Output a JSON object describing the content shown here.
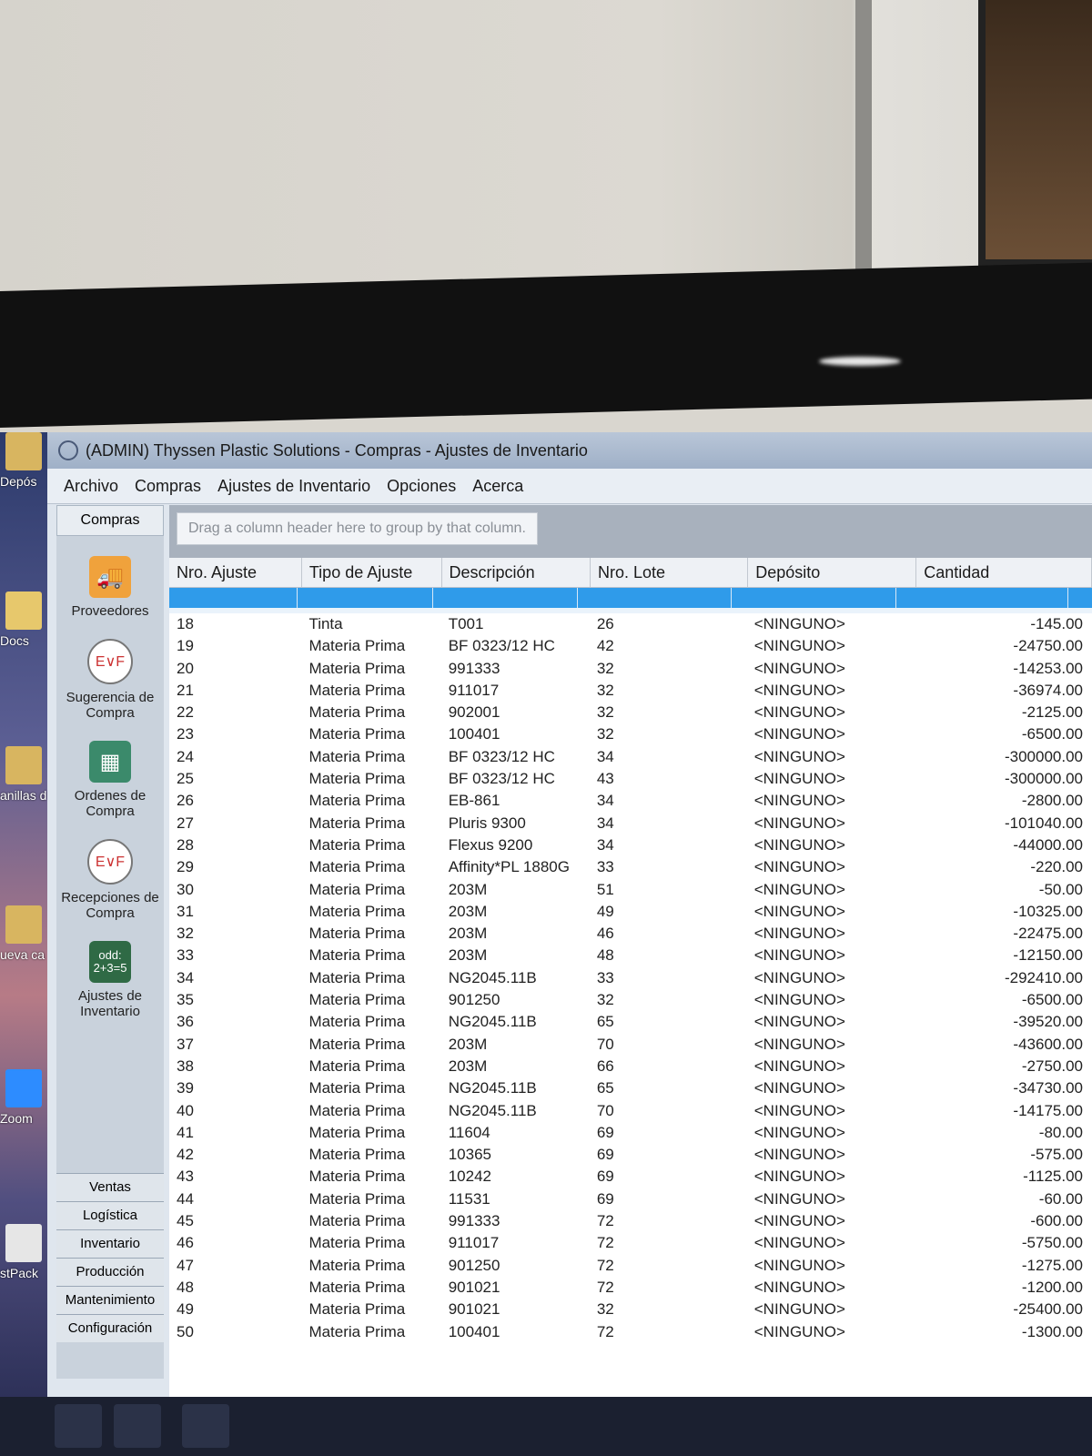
{
  "window": {
    "title": "(ADMIN) Thyssen Plastic Solutions - Compras - Ajustes de Inventario"
  },
  "menu": [
    "Archivo",
    "Compras",
    "Ajustes de Inventario",
    "Opciones",
    "Acerca"
  ],
  "desktop_icons": [
    "Depós",
    "Docs",
    "anillas d",
    "ueva ca",
    "Zoom",
    "stPack"
  ],
  "sidebar": {
    "header": "Compras",
    "items": [
      {
        "label": "Proveedores",
        "icon": "truck-icon"
      },
      {
        "label": "Sugerencia de Compra",
        "icon": "gauge-icon"
      },
      {
        "label": "Ordenes de Compra",
        "icon": "calculator-icon"
      },
      {
        "label": "Recepciones de Compra",
        "icon": "gauge-icon"
      },
      {
        "label": "Ajustes de Inventario",
        "icon": "sum-icon",
        "icon_text": "odd: 2+3=5"
      }
    ],
    "sections": [
      "Ventas",
      "Logística",
      "Inventario",
      "Producción",
      "Mantenimiento",
      "Configuración"
    ]
  },
  "grid": {
    "group_hint": "Drag a column header here to group by that column.",
    "columns": [
      "Nro. Ajuste",
      "Tipo de Ajuste",
      "Descripción",
      "Nro. Lote",
      "Depósito",
      "Cantidad"
    ],
    "rows": [
      [
        "18",
        "Tinta",
        "T001",
        "26",
        "<NINGUNO>",
        "-145.00"
      ],
      [
        "19",
        "Materia Prima",
        "BF 0323/12 HC",
        "42",
        "<NINGUNO>",
        "-24750.00"
      ],
      [
        "20",
        "Materia Prima",
        "991333",
        "32",
        "<NINGUNO>",
        "-14253.00"
      ],
      [
        "21",
        "Materia Prima",
        "911017",
        "32",
        "<NINGUNO>",
        "-36974.00"
      ],
      [
        "22",
        "Materia Prima",
        "902001",
        "32",
        "<NINGUNO>",
        "-2125.00"
      ],
      [
        "23",
        "Materia Prima",
        "100401",
        "32",
        "<NINGUNO>",
        "-6500.00"
      ],
      [
        "24",
        "Materia Prima",
        "BF 0323/12 HC",
        "34",
        "<NINGUNO>",
        "-300000.00"
      ],
      [
        "25",
        "Materia Prima",
        "BF 0323/12 HC",
        "43",
        "<NINGUNO>",
        "-300000.00"
      ],
      [
        "26",
        "Materia Prima",
        "EB-861",
        "34",
        "<NINGUNO>",
        "-2800.00"
      ],
      [
        "27",
        "Materia Prima",
        "Pluris 9300",
        "34",
        "<NINGUNO>",
        "-101040.00"
      ],
      [
        "28",
        "Materia Prima",
        "Flexus 9200",
        "34",
        "<NINGUNO>",
        "-44000.00"
      ],
      [
        "29",
        "Materia Prima",
        "Affinity*PL 1880G",
        "33",
        "<NINGUNO>",
        "-220.00"
      ],
      [
        "30",
        "Materia Prima",
        "203M",
        "51",
        "<NINGUNO>",
        "-50.00"
      ],
      [
        "31",
        "Materia Prima",
        "203M",
        "49",
        "<NINGUNO>",
        "-10325.00"
      ],
      [
        "32",
        "Materia Prima",
        "203M",
        "46",
        "<NINGUNO>",
        "-22475.00"
      ],
      [
        "33",
        "Materia Prima",
        "203M",
        "48",
        "<NINGUNO>",
        "-12150.00"
      ],
      [
        "34",
        "Materia Prima",
        "NG2045.11B",
        "33",
        "<NINGUNO>",
        "-292410.00"
      ],
      [
        "35",
        "Materia Prima",
        "901250",
        "32",
        "<NINGUNO>",
        "-6500.00"
      ],
      [
        "36",
        "Materia Prima",
        "NG2045.11B",
        "65",
        "<NINGUNO>",
        "-39520.00"
      ],
      [
        "37",
        "Materia Prima",
        "203M",
        "70",
        "<NINGUNO>",
        "-43600.00"
      ],
      [
        "38",
        "Materia Prima",
        "203M",
        "66",
        "<NINGUNO>",
        "-2750.00"
      ],
      [
        "39",
        "Materia Prima",
        "NG2045.11B",
        "65",
        "<NINGUNO>",
        "-34730.00"
      ],
      [
        "40",
        "Materia Prima",
        "NG2045.11B",
        "70",
        "<NINGUNO>",
        "-14175.00"
      ],
      [
        "41",
        "Materia Prima",
        "11604",
        "69",
        "<NINGUNO>",
        "-80.00"
      ],
      [
        "42",
        "Materia Prima",
        "10365",
        "69",
        "<NINGUNO>",
        "-575.00"
      ],
      [
        "43",
        "Materia Prima",
        "10242",
        "69",
        "<NINGUNO>",
        "-1125.00"
      ],
      [
        "44",
        "Materia Prima",
        "11531",
        "69",
        "<NINGUNO>",
        "-60.00"
      ],
      [
        "45",
        "Materia Prima",
        "991333",
        "72",
        "<NINGUNO>",
        "-600.00"
      ],
      [
        "46",
        "Materia Prima",
        "911017",
        "72",
        "<NINGUNO>",
        "-5750.00"
      ],
      [
        "47",
        "Materia Prima",
        "901250",
        "72",
        "<NINGUNO>",
        "-1275.00"
      ],
      [
        "48",
        "Materia Prima",
        "901021",
        "72",
        "<NINGUNO>",
        "-1200.00"
      ],
      [
        "49",
        "Materia Prima",
        "901021",
        "32",
        "<NINGUNO>",
        "-25400.00"
      ],
      [
        "50",
        "Materia Prima",
        "100401",
        "72",
        "<NINGUNO>",
        "-1300.00"
      ]
    ]
  }
}
